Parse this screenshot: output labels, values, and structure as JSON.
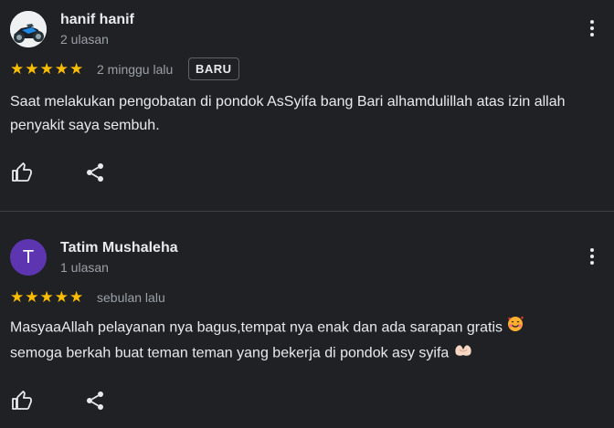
{
  "reviews": [
    {
      "reviewer_name": "hanif hanif",
      "review_count": "2 ulasan",
      "avatar_icon": "motorcycle-avatar",
      "rating": 5,
      "time": "2 minggu lalu",
      "badge": "BARU",
      "text": "Saat melakukan pengobatan di pondok AsSyifa bang Bari alhamdulillah atas izin allah penyakit saya sembuh."
    },
    {
      "reviewer_name": "Tatim Mushaleha",
      "review_count": "1 ulasan",
      "avatar_letter": "T",
      "avatar_color": "#5e35b1",
      "rating": 5,
      "time": "sebulan lalu",
      "text_line1": "MasyaaAllah pelayanan nya bagus,tempat nya enak dan ada sarapan gratis",
      "text_line2": "semoga berkah buat teman teman yang bekerja di pondok asy syifa",
      "emoji_1": "smiling-face-with-hearts",
      "emoji_2": "heart-hands"
    }
  ],
  "icons": {
    "like": "thumb-up-icon",
    "share": "share-icon",
    "more": "more-vert-icon",
    "star": "★"
  },
  "colors": {
    "background": "#202124",
    "star": "#fbbc04",
    "secondary_text": "#9aa0a6"
  }
}
